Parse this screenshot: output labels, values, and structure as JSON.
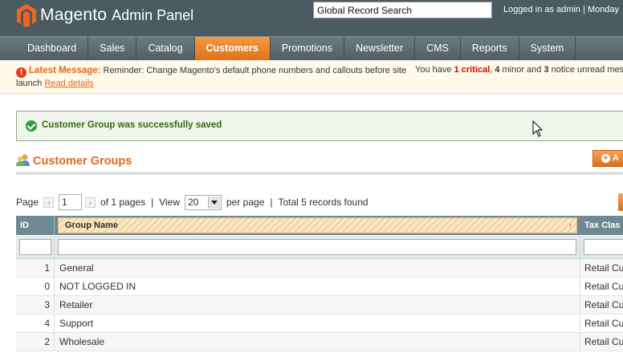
{
  "header": {
    "logo_text": "Magento",
    "logo_sub": "Admin Panel",
    "search_value": "Global Record Search",
    "user_info": "Logged in as admin  |  Monday"
  },
  "nav": {
    "items": [
      "Dashboard",
      "Sales",
      "Catalog",
      "Customers",
      "Promotions",
      "Newsletter",
      "CMS",
      "Reports",
      "System"
    ],
    "active": "Customers"
  },
  "notice": {
    "title": "Latest Message:",
    "text": " Reminder: Change Magento's default phone numbers and callouts before site launch",
    "link": "Read details",
    "right_prefix": "You have ",
    "critical": "1 critical",
    "comma": ", ",
    "minor_count": "4",
    "minor_text": " minor and ",
    "notice_count": "3",
    "notice_text": " notice unread mess"
  },
  "success": {
    "message": "Customer Group was successfully saved"
  },
  "page": {
    "title": "Customer Groups",
    "add_button": "A"
  },
  "pager": {
    "page_label": "Page",
    "page_value": "1",
    "of_pages": "of 1 pages",
    "sep": "|",
    "view_label": "View",
    "view_value": "20",
    "per_page": "per page",
    "total": "Total 5 records found"
  },
  "grid": {
    "columns": [
      "ID",
      "Group Name",
      "Tax Clas"
    ],
    "rows": [
      {
        "id": "1",
        "name": "General",
        "tax": "Retail Cu"
      },
      {
        "id": "0",
        "name": "NOT LOGGED IN",
        "tax": "Retail Cu"
      },
      {
        "id": "3",
        "name": "Retailer",
        "tax": "Retail Cu"
      },
      {
        "id": "4",
        "name": "Support",
        "tax": "Retail Cu"
      },
      {
        "id": "2",
        "name": "Wholesale",
        "tax": "Retail Cu"
      }
    ]
  },
  "colors": {
    "header_bg": "#4b5b61",
    "nav_active": "#e0701a",
    "accent_orange": "#e2691d",
    "success_green": "#3d6611",
    "grid_head": "#6f8992"
  }
}
